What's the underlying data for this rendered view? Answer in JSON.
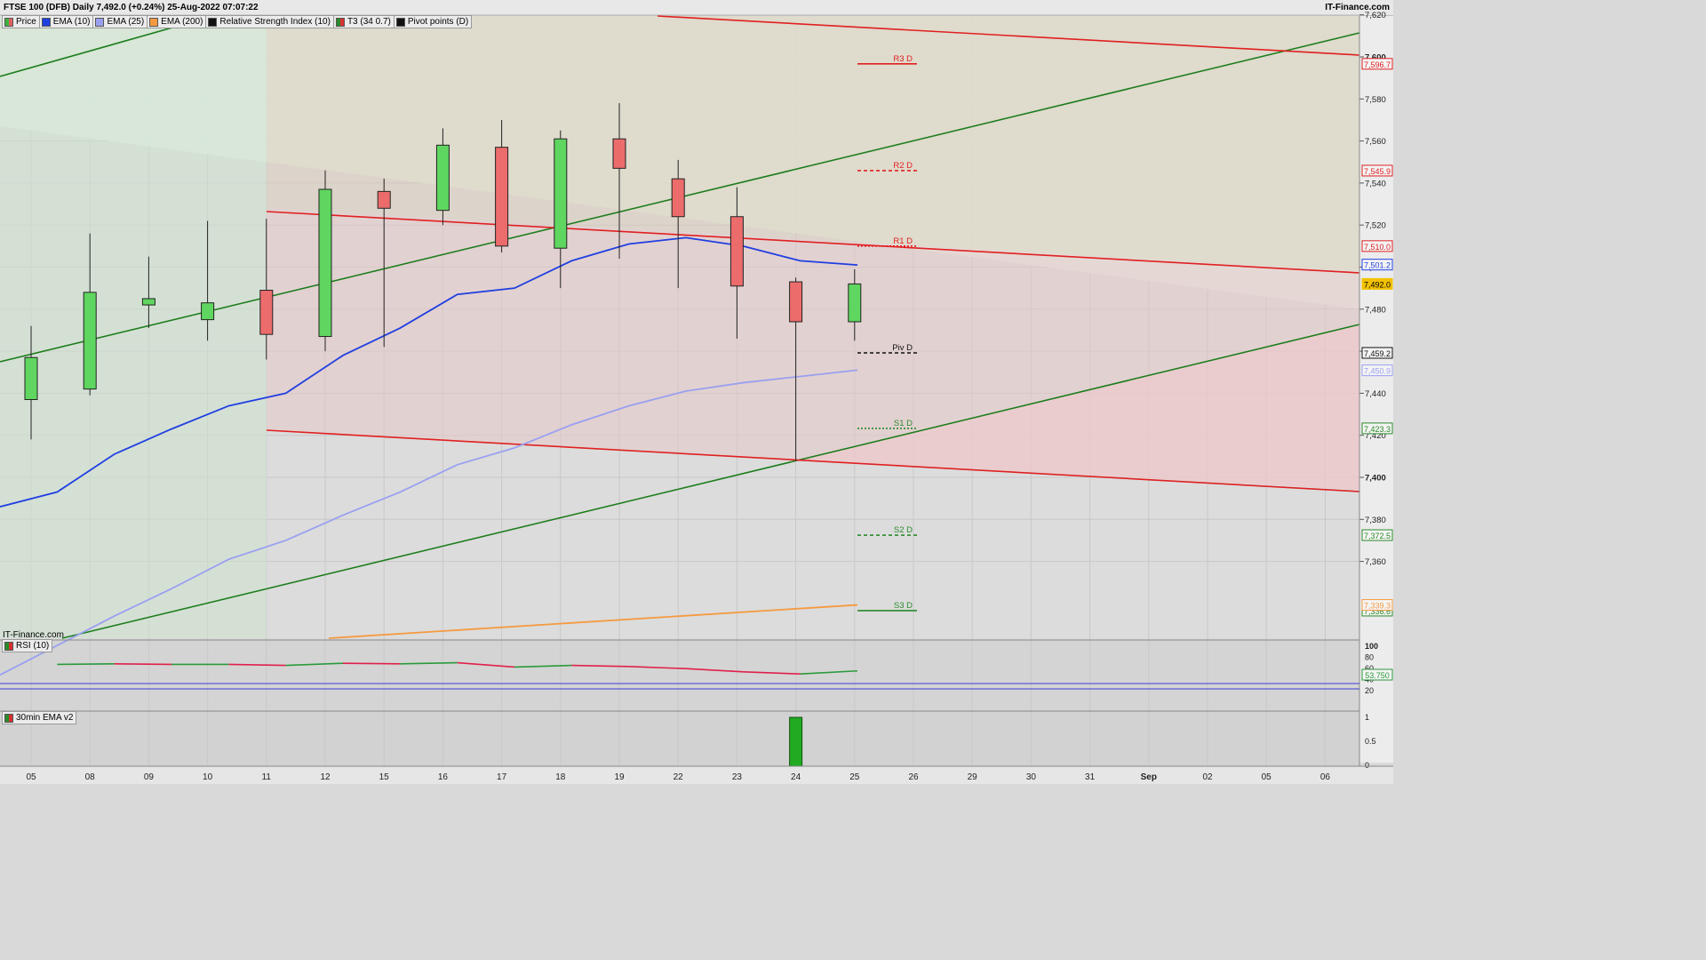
{
  "header": {
    "title": "FTSE 100 (DFB) Daily 7,492.0 (+0.24%) 25-Aug-2022 07:07:22",
    "brand": "IT-Finance.com"
  },
  "legend": [
    {
      "label": "Price",
      "color": "#3cb43c",
      "icon": "price-swatch-icon"
    },
    {
      "label": "EMA (10)",
      "color": "#1f3fe0",
      "icon": "ema10-swatch-icon"
    },
    {
      "label": "EMA (25)",
      "color": "#9aa0f0",
      "icon": "ema25-swatch-icon"
    },
    {
      "label": "EMA (200)",
      "color": "#f59a40",
      "icon": "ema200-swatch-icon"
    },
    {
      "label": "Relative Strength Index (10)",
      "color": "#111111",
      "icon": "rsi-swatch-icon"
    },
    {
      "label": "T3 (34 0.7)",
      "color": "#d83030",
      "icon": "t3-swatch-icon"
    },
    {
      "label": "Pivot points (D)",
      "color": "#111111",
      "icon": "pivot-swatch-icon"
    }
  ],
  "watermark": "IT-Finance.com",
  "rsi_panel": {
    "label": "RSI (10)",
    "value_label": "53.750",
    "ticks": [
      "100",
      "80",
      "60",
      "40",
      "20"
    ]
  },
  "ema_panel": {
    "label": "30min EMA v2",
    "ticks": [
      "1",
      "0.5",
      "0"
    ]
  },
  "chart_data": {
    "type": "candlestick",
    "x_labels": [
      "05",
      "08",
      "09",
      "10",
      "11",
      "12",
      "15",
      "16",
      "17",
      "18",
      "19",
      "22",
      "23",
      "24",
      "25",
      "26",
      "29",
      "30",
      "31",
      "Sep",
      "02",
      "05",
      "06"
    ],
    "y_ticks": [
      7360,
      7380,
      7400,
      7420,
      7440,
      7460,
      7480,
      7500,
      7520,
      7540,
      7560,
      7580,
      7600,
      7620
    ],
    "y_tick_labels": [
      "7,360",
      "7,380",
      "7,400",
      "7,420",
      "7,440",
      "7,460",
      "7,480",
      "7,500",
      "7,520",
      "7,540",
      "7,560",
      "7,580",
      "7,600",
      "7,620"
    ],
    "ylim": [
      7320,
      7625
    ],
    "candles": [
      {
        "x": "05",
        "open": 7437,
        "high": 7472,
        "low": 7418,
        "close": 7457
      },
      {
        "x": "08",
        "open": 7442,
        "high": 7516,
        "low": 7439,
        "close": 7488
      },
      {
        "x": "09",
        "open": 7482,
        "high": 7505,
        "low": 7471,
        "close": 7485
      },
      {
        "x": "10",
        "open": 7475,
        "high": 7522,
        "low": 7465,
        "close": 7483
      },
      {
        "x": "11",
        "open": 7489,
        "high": 7523,
        "low": 7456,
        "close": 7468
      },
      {
        "x": "12",
        "open": 7467,
        "high": 7546,
        "low": 7460,
        "close": 7537
      },
      {
        "x": "15",
        "open": 7536,
        "high": 7542,
        "low": 7462,
        "close": 7528
      },
      {
        "x": "16",
        "open": 7527,
        "high": 7566,
        "low": 7520,
        "close": 7558
      },
      {
        "x": "17",
        "open": 7557,
        "high": 7570,
        "low": 7507,
        "close": 7510
      },
      {
        "x": "18",
        "open": 7509,
        "high": 7565,
        "low": 7490,
        "close": 7561
      },
      {
        "x": "19",
        "open": 7561,
        "high": 7578,
        "low": 7504,
        "close": 7547
      },
      {
        "x": "22",
        "open": 7542,
        "high": 7551,
        "low": 7490,
        "close": 7524
      },
      {
        "x": "23",
        "open": 7524,
        "high": 7538,
        "low": 7466,
        "close": 7491
      },
      {
        "x": "24",
        "open": 7493,
        "high": 7495,
        "low": 7408,
        "close": 7474
      },
      {
        "x": "25",
        "open": 7474,
        "high": 7499,
        "low": 7465,
        "close": 7492
      }
    ],
    "ema10": [
      7386,
      7393,
      7411,
      7423,
      7434,
      7440,
      7458,
      7471,
      7487,
      7490,
      7503,
      7511,
      7514,
      7510,
      7503,
      7501
    ],
    "ema25": [
      7306,
      7320,
      7334,
      7347,
      7361,
      7370,
      7382,
      7393,
      7406,
      7414,
      7425,
      7434,
      7441,
      7445,
      7448,
      7451
    ],
    "ema200": [
      7340,
      7339.3
    ],
    "pivots": [
      {
        "label": "R3 D",
        "value": 7596.7,
        "value_label": "7,596.7",
        "color": "#e02020",
        "style": "solid"
      },
      {
        "label": "R2 D",
        "value": 7545.9,
        "value_label": "7,545.9",
        "color": "#e02020",
        "style": "dashed"
      },
      {
        "label": "R1 D",
        "value": 7510.0,
        "value_label": "7,510.0",
        "color": "#e02020",
        "style": "dotted"
      },
      {
        "label": "Piv D",
        "value": 7459.2,
        "value_label": "7,459.2",
        "color": "#111111",
        "style": "dashed"
      },
      {
        "label": "S1 D",
        "value": 7423.3,
        "value_label": "7,423.3",
        "color": "#2a8a2a",
        "style": "dotted"
      },
      {
        "label": "S2 D",
        "value": 7372.5,
        "value_label": "7,372.5",
        "color": "#2a8a2a",
        "style": "dashed"
      },
      {
        "label": "S3 D",
        "value": 7336.6,
        "value_label": "7,336.6",
        "color": "#2a8a2a",
        "style": "solid"
      }
    ],
    "price_tags": [
      {
        "value": 7501.2,
        "label": "7,501.2",
        "color": "#1f3fe0"
      },
      {
        "value": 7492.0,
        "label": "7,492.0",
        "color": "#f2c200"
      },
      {
        "value": 7450.9,
        "label": "7,450.9",
        "color": "#9aa0f0"
      },
      {
        "value": 7339.3,
        "label": "7,339.3",
        "color": "#f59a40"
      }
    ],
    "rsi": [
      null,
      66,
      67,
      66,
      66,
      64,
      68,
      67,
      69,
      61,
      64,
      62,
      58,
      52,
      48,
      53.75
    ],
    "rsi_levels": [
      70,
      30
    ],
    "ema_bars": [
      {
        "x": "24",
        "value": 1
      }
    ]
  }
}
